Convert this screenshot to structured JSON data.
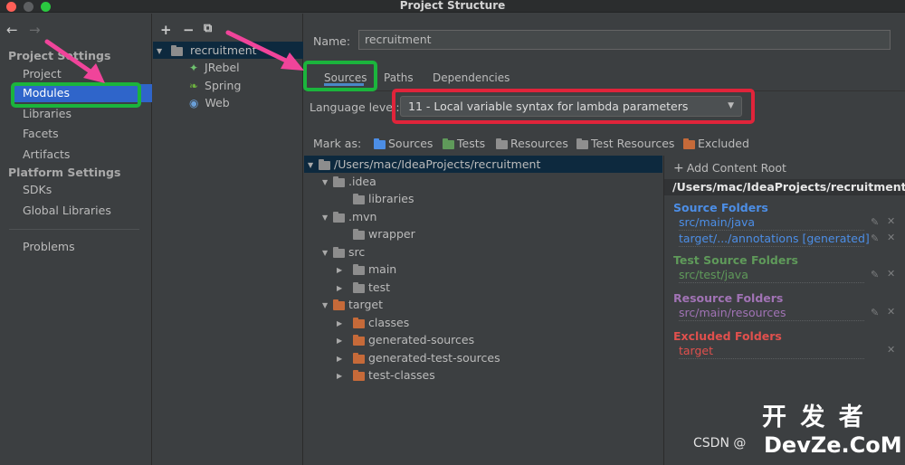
{
  "window": {
    "title": "Project Structure"
  },
  "nav": {
    "project_settings_header": "Project Settings",
    "project_settings_items": [
      "Project",
      "Modules",
      "Libraries",
      "Facets",
      "Artifacts"
    ],
    "platform_settings_header": "Platform Settings",
    "platform_settings_items": [
      "SDKs",
      "Global Libraries"
    ],
    "problems": "Problems",
    "selected": "Modules"
  },
  "modules_toolbar": {
    "add": "+",
    "remove": "−",
    "copy": "⧉"
  },
  "modules_tree": {
    "root": "recruitment",
    "children": [
      "JRebel",
      "Spring",
      "Web"
    ]
  },
  "module": {
    "name_label": "Name:",
    "name_value": "recruitment",
    "tabs": [
      "Sources",
      "Paths",
      "Dependencies"
    ],
    "active_tab": "Sources",
    "language_level_label": "Language level:",
    "language_level_value": "11 - Local variable syntax for lambda parameters",
    "mark_as_label": "Mark as:",
    "mark_as_buttons": [
      "Sources",
      "Tests",
      "Resources",
      "Test Resources",
      "Excluded"
    ]
  },
  "content_tree": {
    "root": "/Users/mac/IdeaProjects/recruitment",
    "items": [
      ".idea",
      "libraries",
      ".mvn",
      "wrapper",
      "src",
      "main",
      "test",
      "target",
      "classes",
      "generated-sources",
      "generated-test-sources",
      "test-classes"
    ]
  },
  "roots_panel": {
    "add_content_root": "Add Content Root",
    "root_path": "/Users/mac/IdeaProjects/recruitment",
    "source_folders_header": "Source Folders",
    "source_folders": [
      "src/main/java",
      "target/.../annotations [generated]"
    ],
    "test_source_folders_header": "Test Source Folders",
    "test_source_folders": [
      "src/test/java"
    ],
    "resource_folders_header": "Resource Folders",
    "resource_folders": [
      "src/main/resources"
    ],
    "excluded_folders_header": "Excluded Folders",
    "excluded_folders": [
      "target"
    ]
  },
  "watermark": {
    "text": "CSDN @",
    "logo_top": "开 发 者",
    "logo_bottom": "DevZe.CoM"
  },
  "colors": {
    "selection": "#2f65ca",
    "source_blue": "#4c8ee6",
    "test_green": "#5f9a5a",
    "resource_purple": "#a173b5",
    "excluded_red": "#e0504d",
    "folder_blue": "#5a8fc2",
    "folder_grey": "#8d8d8d",
    "folder_orange": "#c66a39",
    "annotation_green": "#1bb43c",
    "annotation_red": "#e0243a",
    "annotation_pink": "#f0449a"
  }
}
